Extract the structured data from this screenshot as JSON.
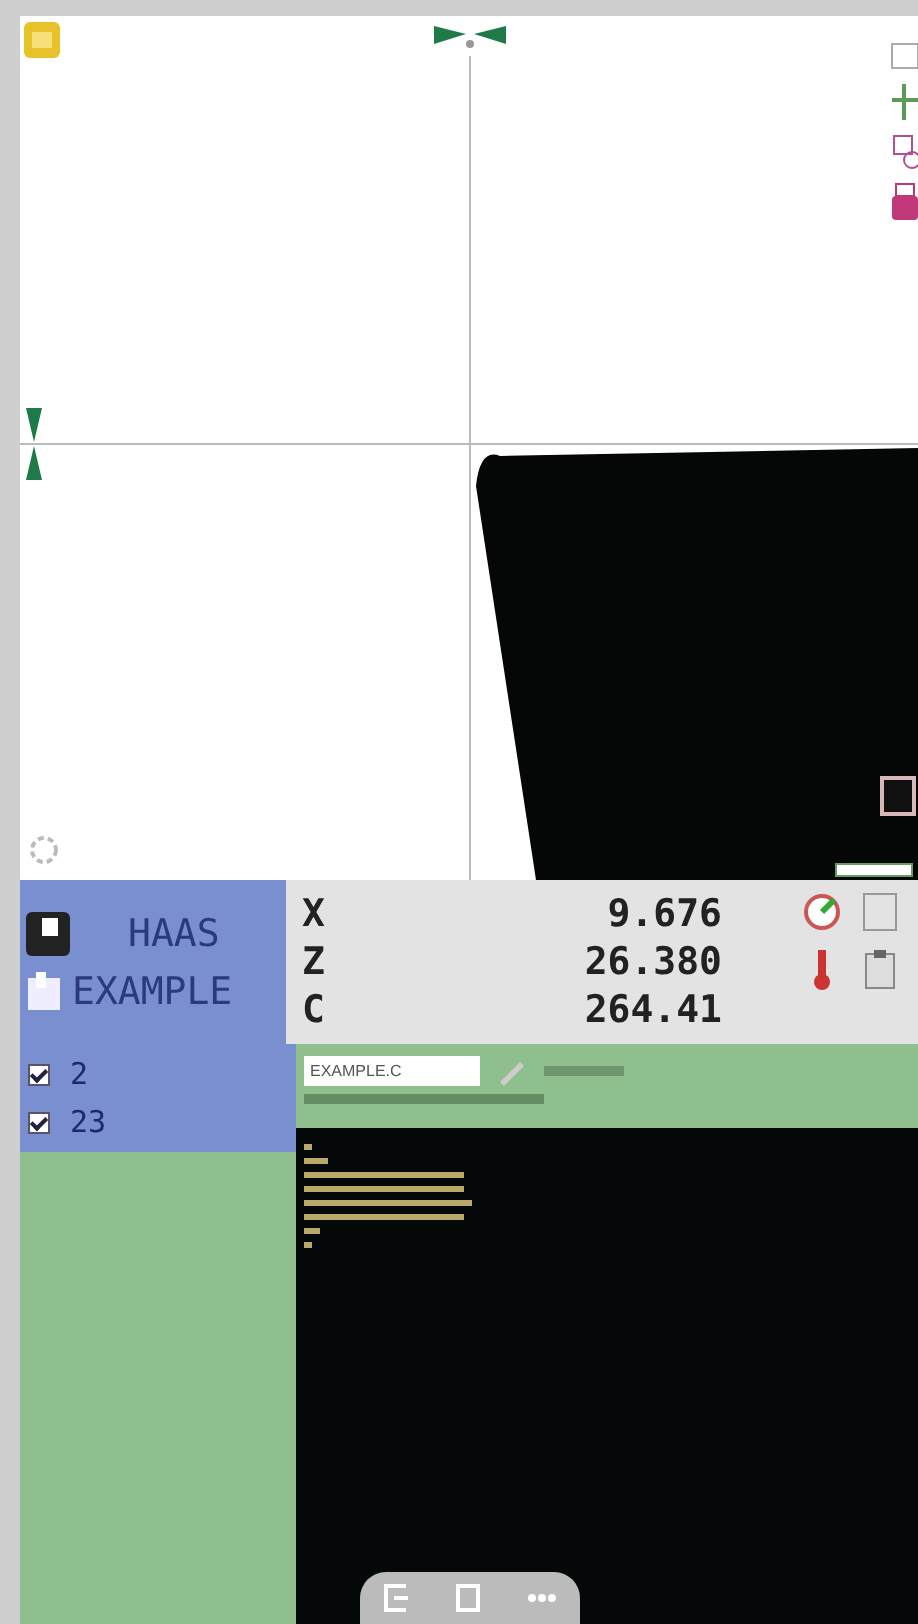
{
  "machine": {
    "name": "HAAS",
    "program": "EXAMPLE"
  },
  "axes": [
    {
      "label": "X",
      "value": "9.676"
    },
    {
      "label": "Z",
      "value": "26.380"
    },
    {
      "label": "C",
      "value": "264.41"
    }
  ],
  "files": [
    {
      "label": "2",
      "checked": true
    },
    {
      "label": "23",
      "checked": true
    }
  ],
  "program_field": {
    "value": "EXAMPLE.C"
  }
}
